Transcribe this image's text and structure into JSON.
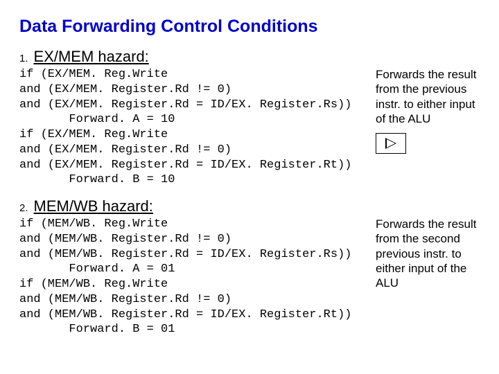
{
  "title": "Data Forwarding Control Conditions",
  "sections": [
    {
      "num": "1.",
      "heading": "EX/MEM hazard:",
      "code": "if (EX/MEM. Reg.Write\nand (EX/MEM. Register.Rd != 0)\nand (EX/MEM. Register.Rd = ID/EX. Register.Rs))\n       Forward. A = 10\nif (EX/MEM. Reg.Write\nand (EX/MEM. Register.Rd != 0)\nand (EX/MEM. Register.Rd = ID/EX. Register.Rt))\n       Forward. B = 10",
      "annotation": "Forwards the result from the previous instr. to either input of the ALU"
    },
    {
      "num": "2.",
      "heading": "MEM/WB hazard:",
      "code": "if (MEM/WB. Reg.Write\nand (MEM/WB. Register.Rd != 0)\nand (MEM/WB. Register.Rd = ID/EX. Register.Rs))\n       Forward. A = 01\nif (MEM/WB. Reg.Write\nand (MEM/WB. Register.Rd != 0)\nand (MEM/WB. Register.Rd = ID/EX. Register.Rt))\n       Forward. B = 01",
      "annotation": "Forwards the result from the second previous instr. to either input of the ALU"
    }
  ]
}
